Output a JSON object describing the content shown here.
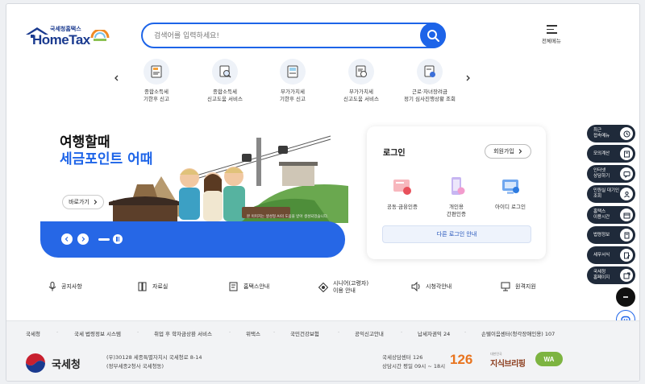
{
  "header": {
    "logo_sub": "국세청홈택스",
    "logo_main": "HomeTax",
    "search_placeholder": "검색어를 입력하세요!",
    "menu_all_label": "전체메뉴"
  },
  "quick_menu": [
    {
      "label1": "종합소득세",
      "label2": "기한후 신고",
      "icon": "tax-document-icon"
    },
    {
      "label1": "종합소득세",
      "label2": "신고도움 서비스",
      "icon": "tax-search-icon"
    },
    {
      "label1": "부가가치세",
      "label2": "기한후 신고",
      "icon": "vat-document-icon"
    },
    {
      "label1": "부가가치세",
      "label2": "신고도움 서비스",
      "icon": "vat-help-icon"
    },
    {
      "label1": "근로·자녀장려금",
      "label2": "정기 심사진행상황 조회",
      "icon": "incentive-icon"
    }
  ],
  "banner": {
    "title1": "여행할때",
    "title2": "세금포인트 어때",
    "go_label": "바로가기",
    "note": "본 이미지는 생성형 AI의 도움을 받아 생성되었습니다."
  },
  "login": {
    "title": "로그인",
    "join_label": "회원가입",
    "options": [
      {
        "label1": "공동·금융인증",
        "label2": ""
      },
      {
        "label1": "개인용",
        "label2": "간편인증"
      },
      {
        "label1": "아이디 로그인",
        "label2": ""
      }
    ],
    "other_label": "다른 로그인 안내"
  },
  "info_row": [
    {
      "label1": "공지사항",
      "label2": ""
    },
    {
      "label1": "자료실",
      "label2": ""
    },
    {
      "label1": "홈택스안내",
      "label2": ""
    },
    {
      "label1": "시니어(고령자)",
      "label2": "이용 안내"
    },
    {
      "label1": "시청각안내",
      "label2": ""
    },
    {
      "label1": "원격지원",
      "label2": ""
    }
  ],
  "side_menu": [
    {
      "label1": "최근",
      "label2": "접속메뉴"
    },
    {
      "label1": "모의계산",
      "label2": ""
    },
    {
      "label1": "인터넷",
      "label2": "상담하기"
    },
    {
      "label1": "민원실 대기인",
      "label2": "조회"
    },
    {
      "label1": "홈택스",
      "label2": "이용시간"
    },
    {
      "label1": "법령정보",
      "label2": ""
    },
    {
      "label1": "세무서식",
      "label2": ""
    },
    {
      "label1": "국세청",
      "label2": "홈페이지"
    }
  ],
  "footer": {
    "links": [
      "국세청",
      "국세 법령정보 시스템",
      "취업 후 학자금상환 서비스",
      "위택스",
      "국민건강보험",
      "공익신고안내",
      "납세자권익 24",
      "손텔이음센터(청각장애인용) 107"
    ],
    "org_name": "국세청",
    "address1": "(우)30128 세종특별자치시 국세청로 8-14",
    "address2": "(정부세종2청사 국세청동)",
    "call_center": "국세상담센터 126",
    "call_hours": "상담시간 평일 09시 ~ 18시",
    "badge_126": "126",
    "policy_small": "대한민국",
    "policy_big": "지식브리핑",
    "gov_badge": "WA"
  },
  "colors": {
    "primary": "#1d64e8",
    "banner_blue": "#2667e6",
    "dark": "#1f2a3a"
  }
}
